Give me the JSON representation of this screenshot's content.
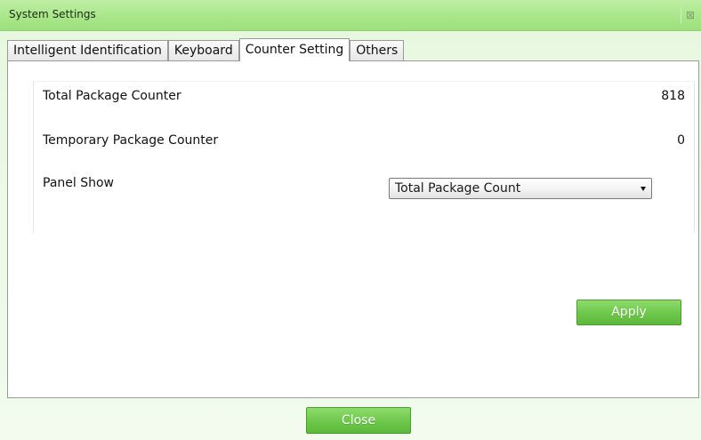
{
  "window": {
    "title": "System Settings",
    "close_glyph": "⊠"
  },
  "tabs": [
    {
      "label": "Intelligent Identification",
      "active": false
    },
    {
      "label": "Keyboard",
      "active": false
    },
    {
      "label": "Counter Setting",
      "active": true
    },
    {
      "label": "Others",
      "active": false
    }
  ],
  "counter": {
    "total_label": "Total Package Counter",
    "total_value": "818",
    "temporary_label": "Temporary Package Counter",
    "temporary_value": "0",
    "panel_show_label": "Panel Show",
    "panel_show_selected": "Total Package Count"
  },
  "buttons": {
    "apply": "Apply",
    "close": "Close"
  },
  "colors": {
    "accent_green": "#6fc94c",
    "titlebar_green": "#a9e68a"
  }
}
